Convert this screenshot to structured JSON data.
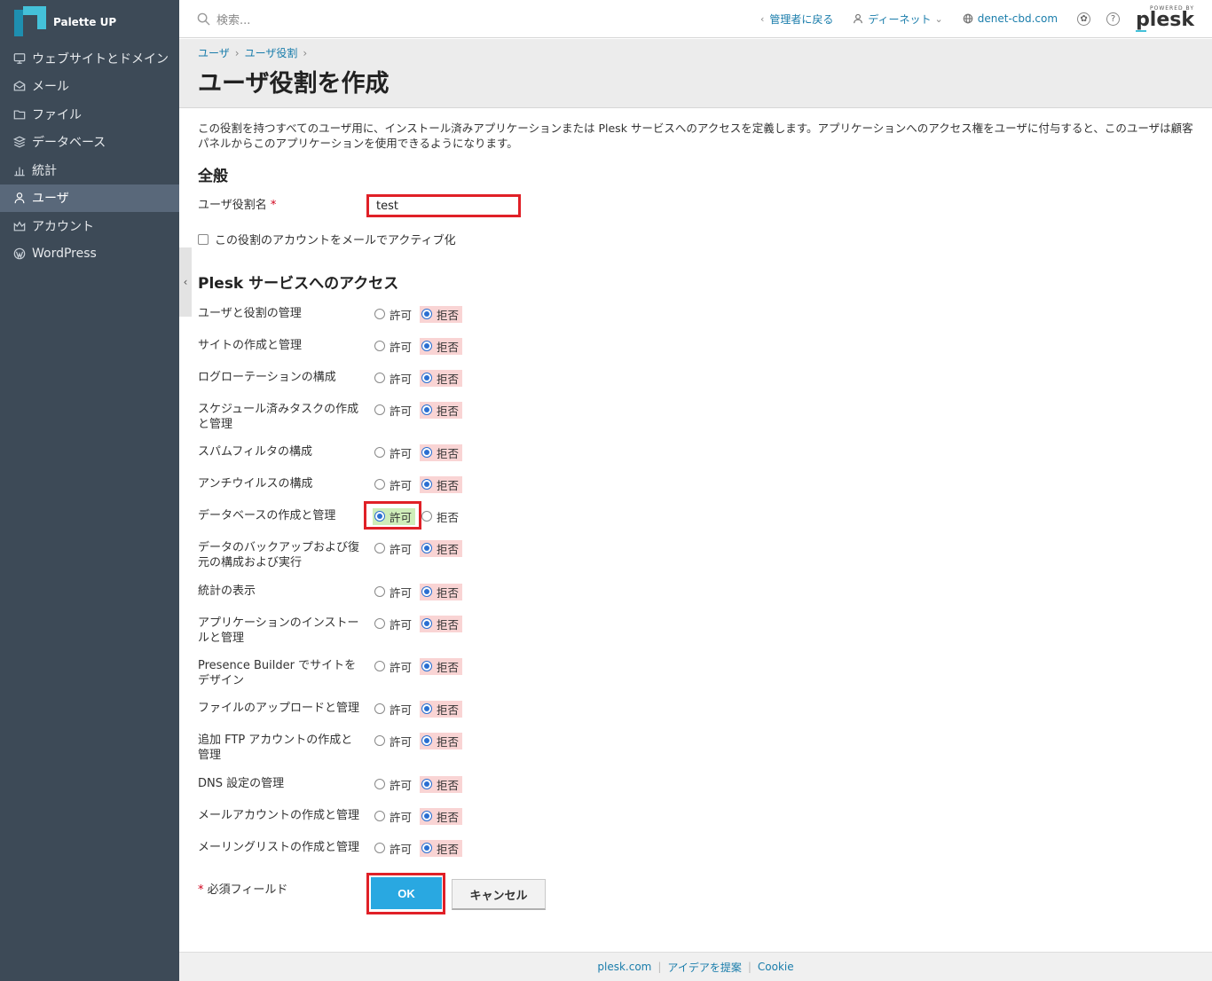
{
  "brand": {
    "name": "Palette UP"
  },
  "sidebar": {
    "items": [
      {
        "label": "ウェブサイトとドメイン",
        "icon": "monitor-icon",
        "active": false
      },
      {
        "label": "メール",
        "icon": "mail-icon",
        "active": false
      },
      {
        "label": "ファイル",
        "icon": "folder-icon",
        "active": false
      },
      {
        "label": "データベース",
        "icon": "database-icon",
        "active": false
      },
      {
        "label": "統計",
        "icon": "chart-icon",
        "active": false
      },
      {
        "label": "ユーザ",
        "icon": "user-icon",
        "active": true
      },
      {
        "label": "アカウント",
        "icon": "crown-icon",
        "active": false
      },
      {
        "label": "WordPress",
        "icon": "wordpress-icon",
        "active": false
      }
    ]
  },
  "topbar": {
    "search_placeholder": "検索...",
    "back_to_admin": "管理者に戻る",
    "account_name": "ディーネット",
    "domain": "denet-cbd.com",
    "logo_small": "POWERED BY",
    "logo_main": "plesk"
  },
  "breadcrumb": {
    "item1": "ユーザ",
    "item2": "ユーザ役割"
  },
  "page": {
    "title": "ユーザ役割を作成"
  },
  "form": {
    "description": "この役割を持つすべてのユーザ用に、インストール済みアプリケーションまたは Plesk サービスへのアクセスを定義します。アプリケーションへのアクセス権をユーザに付与すると、このユーザは顧客パネルからこのアプリケーションを使用できるようになります。",
    "general_title": "全般",
    "role_name_label": "ユーザ役割名",
    "required_mark": "*",
    "role_name_value": "test",
    "activate_checkbox_label": "この役割のアカウントをメールでアクティブ化",
    "access_title": "Plesk サービスへのアクセス",
    "allow_label": "許可",
    "deny_label": "拒否",
    "permissions": [
      {
        "label": "ユーザと役割の管理",
        "value": "deny"
      },
      {
        "label": "サイトの作成と管理",
        "value": "deny"
      },
      {
        "label": "ログローテーションの構成",
        "value": "deny"
      },
      {
        "label": "スケジュール済みタスクの作成と管理",
        "value": "deny"
      },
      {
        "label": "スパムフィルタの構成",
        "value": "deny"
      },
      {
        "label": "アンチウイルスの構成",
        "value": "deny"
      },
      {
        "label": "データベースの作成と管理",
        "value": "allow"
      },
      {
        "label": "データのバックアップおよび復元の構成および実行",
        "value": "deny"
      },
      {
        "label": "統計の表示",
        "value": "deny"
      },
      {
        "label": "アプリケーションのインストールと管理",
        "value": "deny"
      },
      {
        "label": "Presence Builder でサイトをデザイン",
        "value": "deny"
      },
      {
        "label": "ファイルのアップロードと管理",
        "value": "deny"
      },
      {
        "label": "追加 FTP アカウントの作成と管理",
        "value": "deny"
      },
      {
        "label": "DNS 設定の管理",
        "value": "deny"
      },
      {
        "label": "メールアカウントの作成と管理",
        "value": "deny"
      },
      {
        "label": "メーリングリストの作成と管理",
        "value": "deny"
      }
    ],
    "required_note": "必須フィールド",
    "ok_label": "OK",
    "cancel_label": "キャンセル"
  },
  "footer": {
    "link1": "plesk.com",
    "link2": "アイデアを提案",
    "link3": "Cookie"
  },
  "colors": {
    "sidebar_bg": "#3d4a57",
    "accent": "#29a8e1",
    "link": "#1a7dab",
    "highlight": "#e02027"
  }
}
